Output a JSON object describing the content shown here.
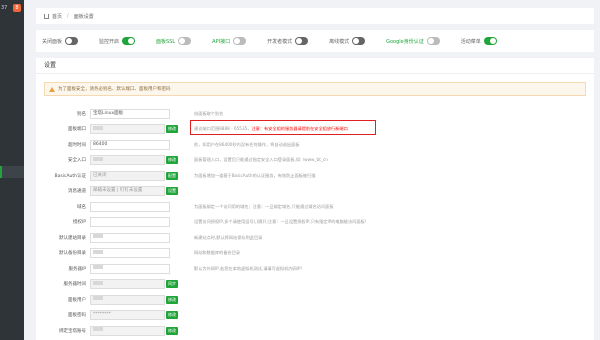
{
  "sidebar": {
    "version": "37",
    "badge": "8"
  },
  "breadcrumb": {
    "home": "首页",
    "current": "面板设置"
  },
  "toggles": [
    {
      "label": "关闭面板",
      "on": false
    },
    {
      "label": "监控开启",
      "on": true
    },
    {
      "label": "面板SSL",
      "on": false,
      "green": true
    },
    {
      "label": "API接口",
      "on": false,
      "green": true
    },
    {
      "label": "开发者模式",
      "on": false
    },
    {
      "label": "离线模式",
      "on": false
    },
    {
      "label": "Google身份认证",
      "on": false,
      "green": true
    },
    {
      "label": "活动菜单",
      "on": true
    }
  ],
  "panel": {
    "title": "设置",
    "tip": "为了面板安全，请务必别名、默认端口、面板用户和密码"
  },
  "rows": [
    {
      "label": "别名",
      "value": "宝塔Linux面板",
      "desc": "给面板取个别名"
    },
    {
      "label": "面板端口",
      "value": "",
      "button": "修改",
      "desc": "建议端口范围8888 - 65535，",
      "desc_red": "注意：有安全组的服务器请提前在安全组放行新端口"
    },
    {
      "label": "超时时间",
      "value": "86400",
      "desc": "秒，如用户在86400秒内没有任何操作，将自动退出面板"
    },
    {
      "label": "安全入口",
      "value": "",
      "button": "修改",
      "desc": "面板管理入口，设置后只能通过指定安全入口登录面板,如: /www_bt_cn"
    },
    {
      "label": "BasicAuth认证",
      "value": "已关闭",
      "button": "配置",
      "desc": "为面板增加一道基于BasicAuth的认证服务，有效防止面板被扫描"
    },
    {
      "label": "消息通道",
      "value": "邮箱未设置 | 钉钉未设置",
      "button": "设置",
      "desc": ""
    },
    {
      "label": "域名",
      "value": "",
      "desc": "为面板绑定一个访问用的域名；注意：一旦绑定域名,只能通过域名访问面板"
    },
    {
      "label": "授权IP",
      "value": "",
      "desc": "设置访问授权IP,多个请使用逗号(,)隔开;注意：一旦设置授权IP,只有指定IP的电脑能访问面板!"
    },
    {
      "label": "默认建站目录",
      "value": "",
      "desc": "新建站点时,默认将网站保存到此目录"
    },
    {
      "label": "默认备份目录",
      "value": "",
      "desc": "网站和数据库的备份目录"
    },
    {
      "label": "服务器IP",
      "value": "",
      "desc": "默认为外网IP,若您在本地虚拟机测试,请填写虚拟机内网IP!"
    },
    {
      "label": "服务器时间",
      "value": "",
      "button": "同步",
      "desc": ""
    },
    {
      "label": "面板用户",
      "value": "",
      "button": "修改",
      "desc": ""
    },
    {
      "label": "面板密码",
      "value": "********",
      "button": "修改",
      "desc": ""
    },
    {
      "label": "绑定宝塔账号",
      "value": "",
      "button": "修改",
      "desc": ""
    }
  ]
}
